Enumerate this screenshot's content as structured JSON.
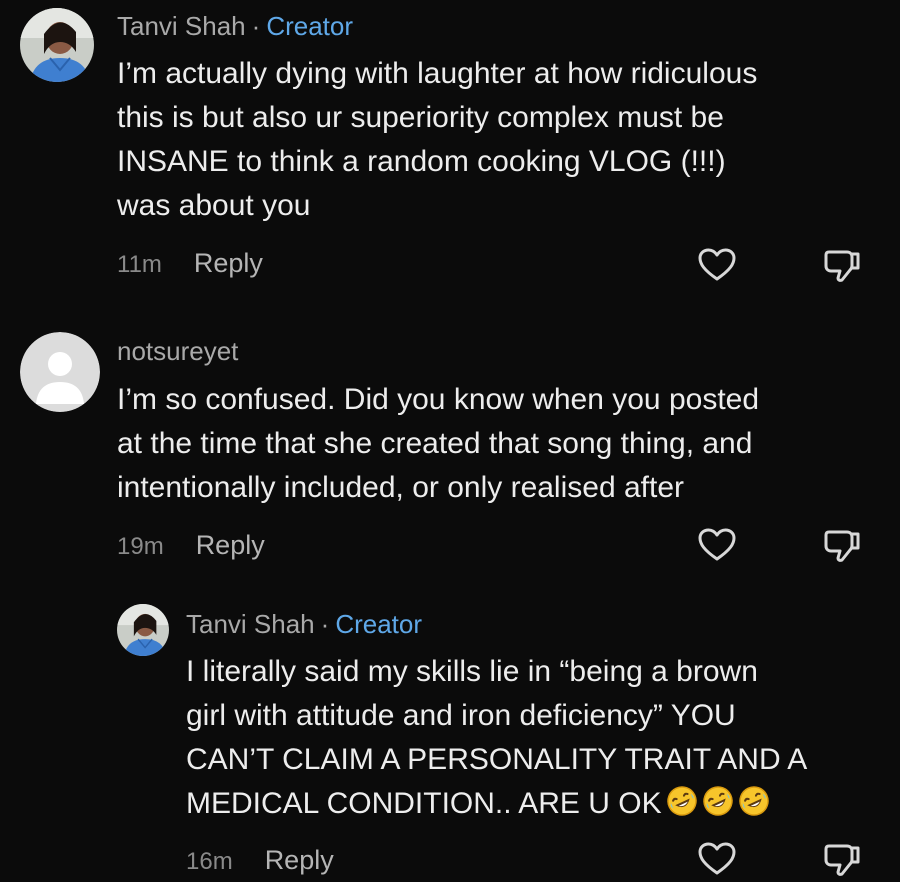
{
  "comments": [
    {
      "author": "Tanvi Shah",
      "separator": "·",
      "badge": "Creator",
      "avatar": "creator-avatar",
      "text": "I’m actually dying with laughter at how ridiculous\nthis is but also ur superiority complex must be\nINSANE to think a random cooking VLOG (!!!)\nwas about you",
      "time": "11m",
      "reply_label": "Reply"
    },
    {
      "author": "notsureyet",
      "avatar": "default-user-avatar",
      "text": "I’m so confused. Did you know when you posted\nat the time that she created that song thing, and\nintentionally included, or only realised after",
      "time": "19m",
      "reply_label": "Reply"
    },
    {
      "author": "Tanvi Shah",
      "separator": "·",
      "badge": "Creator",
      "avatar": "creator-avatar",
      "text": "I literally said my skills lie in “being a brown\ngirl with attitude and iron deficiency” YOU\nCAN’T CLAIM A PERSONALITY TRAIT AND A\nMEDICAL CONDITION.. ARE U OK",
      "emojis": [
        "rolling-on-floor-laughing-emoji",
        "rolling-on-floor-laughing-emoji",
        "rolling-on-floor-laughing-emoji"
      ],
      "time": "16m",
      "reply_label": "Reply"
    }
  ],
  "icons": {
    "like": "heart-outline-icon",
    "dislike": "thumbs-down-icon"
  },
  "colors": {
    "background": "#0b0b0b",
    "creator_badge": "#5fa8e8",
    "meta_text": "#8a8a8a"
  }
}
